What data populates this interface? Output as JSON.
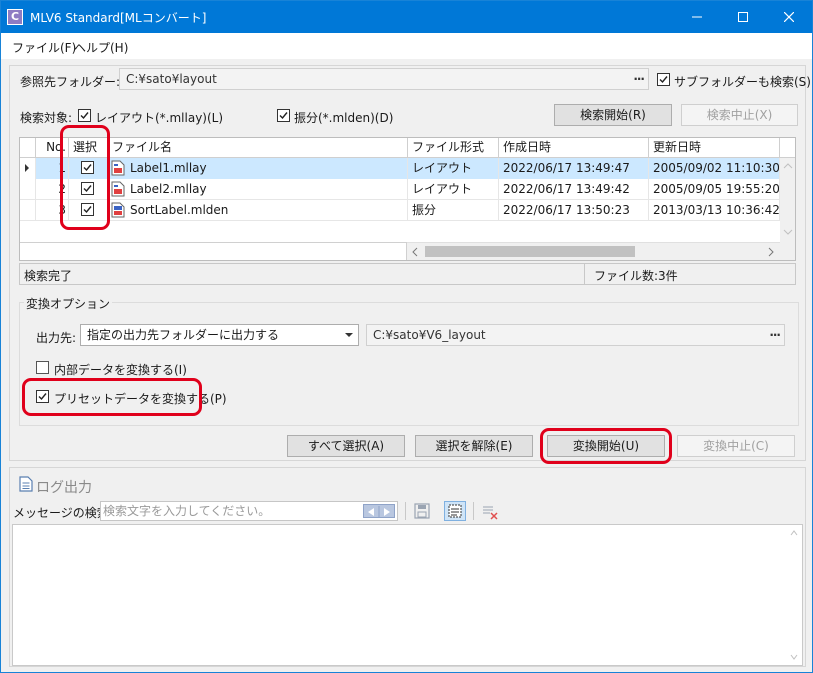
{
  "window": {
    "app_icon_letter": "C",
    "title": "MLV6 Standard[MLコンバート]"
  },
  "menu": [
    {
      "label": "ファイル(F)"
    },
    {
      "label": "ヘルプ(H)"
    }
  ],
  "reference": {
    "label": "参照先フォルダー:",
    "path": "C:¥sato¥layout",
    "browse": "···",
    "subfolder_label": "サブフォルダーも検索(S)",
    "subfolder_checked": true
  },
  "search_target": {
    "label": "検索対象:",
    "layout_label": "レイアウト(*.mllay)(L)",
    "layout_checked": true,
    "fuwake_label": "振分(*.mlden)(D)",
    "fuwake_checked": true,
    "start_button": "検索開始(R)",
    "stop_button": "検索中止(X)"
  },
  "grid": {
    "columns": [
      "No.",
      "選択",
      "ファイル名",
      "ファイル形式",
      "作成日時",
      "更新日時"
    ],
    "rows": [
      {
        "no": "1",
        "checked": true,
        "name": "Label1.mllay",
        "type": "レイアウト",
        "created": "2022/06/17 13:49:47",
        "updated": "2005/09/02 11:10:30",
        "icon": "layout-file-icon"
      },
      {
        "no": "2",
        "checked": true,
        "name": "Label2.mllay",
        "type": "レイアウト",
        "created": "2022/06/17 13:49:42",
        "updated": "2005/09/05 19:55:20",
        "icon": "layout-file-icon"
      },
      {
        "no": "3",
        "checked": true,
        "name": "SortLabel.mlden",
        "type": "振分",
        "created": "2022/06/17 13:50:23",
        "updated": "2013/03/13 10:36:42",
        "icon": "sort-file-icon"
      }
    ]
  },
  "status": {
    "left": "検索完了",
    "right": "ファイル数:3件"
  },
  "convert_options": {
    "title": "変換オプション",
    "output_label": "出力先:",
    "output_select": "指定の出力先フォルダーに出力する",
    "output_path": "C:¥sato¥V6_layout",
    "browse": "···",
    "internal_label": "内部データを変換する(I)",
    "internal_checked": false,
    "preset_label": "プリセットデータを変換する(P)",
    "preset_checked": true
  },
  "buttons": {
    "select_all": "すべて選択(A)",
    "deselect": "選択を解除(E)",
    "convert_start": "変換開始(U)",
    "convert_stop": "変換中止(C)"
  },
  "log": {
    "title": "ログ出力",
    "search_label": "メッセージの検索:",
    "search_placeholder": "検索文字を入力してください。"
  },
  "colors": {
    "title_bar": "#0078d7",
    "selected_row": "#cce8ff",
    "highlight_ring": "#e0001b"
  }
}
